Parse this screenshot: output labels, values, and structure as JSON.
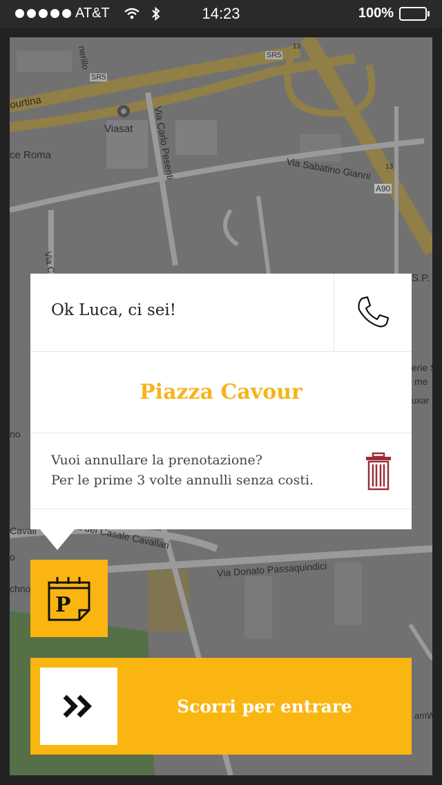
{
  "status_bar": {
    "carrier": "AT&T",
    "time": "14:23",
    "battery": "100%",
    "signal_icon": "signal-dots-icon",
    "wifi_icon": "wifi-icon",
    "bluetooth_icon": "bluetooth-icon",
    "battery_icon": "battery-icon"
  },
  "map": {
    "labels": {
      "tiburtina": "ourtina",
      "viasat": "Viasat",
      "via_carlo_pesenti": "Via Carlo Pesenti",
      "ce_roma": "ce Roma",
      "via_sabatino_gianni": "Via Sabatino Gianni",
      "a90": "A90",
      "sr5_a": "SR5",
      "sr5_b": "SR5",
      "road_13_a": "13",
      "road_13_b": "13",
      "nerillo": "nerillo",
      "via_c": "Via C",
      "sp": "S.P.",
      "erie_s": "erie S",
      "me": "me",
      "uxar": "uxar",
      "no": "no",
      "cavall": "Cavall",
      "via_del_casale_cavallari": "Via del Casale Cavallari",
      "via_donato_passaquindici": "Via Donato Passaquindici",
      "chno": "chno",
      "o": "o",
      "amw": "amW"
    },
    "colors": {
      "background": "#7b7b7b",
      "road": "#a8a8a8",
      "highway": "#9d8a4c",
      "park": "#5d7a4e"
    }
  },
  "card": {
    "greeting": "Ok Luca, ci sei!",
    "phone_icon": "phone-icon",
    "place": "Piazza Cavour",
    "cancel_line1": "Vuoi annullare la prenotazione?",
    "cancel_line2": "Per le prime 3 volte annulli senza costi.",
    "trash_icon": "trash-icon",
    "accent": "#f4b41a",
    "trash_color": "#9b2c37"
  },
  "parking_button": {
    "icon": "parking-calendar-icon",
    "letter": "P",
    "color": "#fbb511"
  },
  "slider": {
    "label": "Scorri per entrare",
    "handle_icon": "double-chevron-right-icon",
    "color": "#fbb511"
  }
}
